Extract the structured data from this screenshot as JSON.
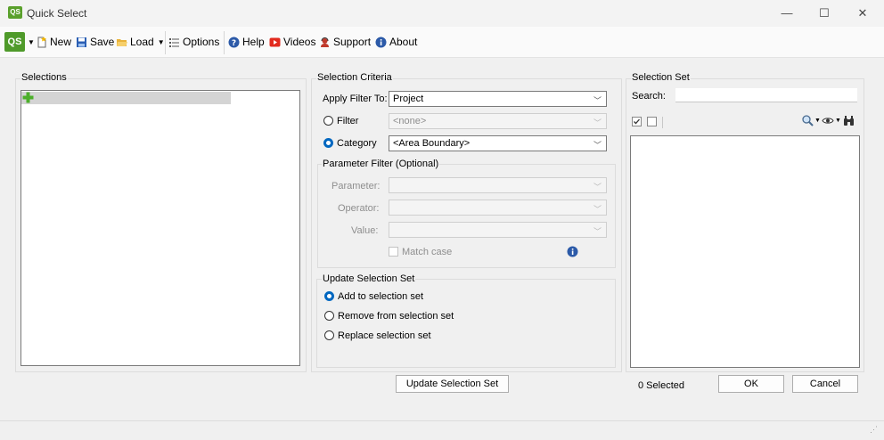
{
  "window": {
    "app_icon": "QS",
    "title": "Quick Select",
    "minimize_icon": "minimize-icon",
    "maximize_icon": "maximize-icon",
    "close_icon": "close-icon"
  },
  "toolbar": {
    "logo_label": "QS",
    "new_label": "New",
    "save_label": "Save",
    "load_label": "Load",
    "options_label": "Options",
    "help_label": "Help",
    "videos_label": "Videos",
    "support_label": "Support",
    "about_label": "About"
  },
  "selections": {
    "title": "Selections"
  },
  "criteria": {
    "title": "Selection Criteria",
    "apply_filter_label": "Apply Filter To:",
    "apply_filter_value": "Project",
    "filter_label": "Filter",
    "filter_value": "<none>",
    "category_label": "Category",
    "category_value": "<Area Boundary>",
    "selected_mode": "category",
    "parameter_filter": {
      "title": "Parameter Filter (Optional)",
      "parameter_label": "Parameter:",
      "operator_label": "Operator:",
      "value_label": "Value:",
      "match_case_label": "Match case"
    }
  },
  "update_set": {
    "title": "Update Selection Set",
    "options": [
      {
        "label": "Add to selection set",
        "selected": true
      },
      {
        "label": "Remove from selection set",
        "selected": false
      },
      {
        "label": "Replace selection set",
        "selected": false
      }
    ],
    "button_label": "Update Selection Set"
  },
  "selection_set": {
    "title": "Selection Set",
    "search_label": "Search:",
    "search_value": "",
    "status": "0 Selected",
    "ok_label": "OK",
    "cancel_label": "Cancel"
  },
  "colors": {
    "accent": "#0067c0",
    "logo_green": "#4f9a2a"
  }
}
